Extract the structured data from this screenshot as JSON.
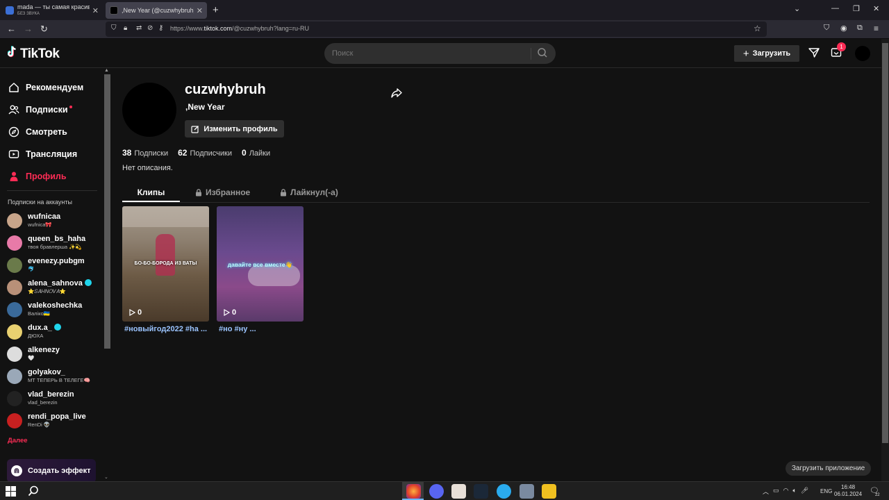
{
  "browser": {
    "tabs": [
      {
        "title": "mada — ты самая красивая (s",
        "subtitle": "БЕЗ ЗВУКА"
      },
      {
        "title": ",New Year (@cuzwhybruh) | Tik"
      }
    ],
    "url_prefix": "https://www.",
    "url_domain": "tiktok.com",
    "url_rest": "/@cuzwhybruh?lang=ru-RU"
  },
  "header": {
    "logo_text": "TikTok",
    "search_placeholder": "Поиск",
    "upload_label": "Загрузить",
    "inbox_badge": "1"
  },
  "sidebar": {
    "nav": [
      {
        "label": "Рекомендуем"
      },
      {
        "label": "Подписки"
      },
      {
        "label": "Смотреть"
      },
      {
        "label": "Трансляция"
      },
      {
        "label": "Профиль"
      }
    ],
    "following_heading": "Подписки на аккаунты",
    "accounts": [
      {
        "name": "wufnicaa",
        "desc": "wufnica🎀",
        "color": "#c8a58a"
      },
      {
        "name": "queen_bs_haha",
        "desc": "твоя бравлерша ✨💫",
        "color": "#e87aa8"
      },
      {
        "name": "evenezy.pubgm",
        "desc": "🐬",
        "color": "#6a7a4a"
      },
      {
        "name": "alena_sahnova",
        "desc": "⭐𝑆𝐴𝐻𝑁𝑂𝑉𝐴⭐",
        "color": "#b89078"
      },
      {
        "name": "valekoshechka",
        "desc": "Валiко🇺🇦",
        "color": "#3a6a9a"
      },
      {
        "name": "dux.a_",
        "desc": "ДЮХА",
        "color": "#e8d070"
      },
      {
        "name": "alkenezy",
        "desc": "🤍",
        "color": "#dddddd"
      },
      {
        "name": "golyakov_",
        "desc": "МТ ТЕПЕРЬ В ТЕЛЕГЕ🧠",
        "color": "#9aa8b8"
      },
      {
        "name": "vlad_berezin",
        "desc": "vlad_berezin",
        "color": "#222222"
      },
      {
        "name": "rendi_popa_live",
        "desc": "RenDi 👽",
        "color": "#c82020"
      }
    ],
    "more_label": "Далее",
    "effect_label": "Создать эффект"
  },
  "profile": {
    "username": "cuzwhybruh",
    "nickname": ",New Year",
    "edit_label": "Изменить профиль",
    "stats": [
      {
        "value": "38",
        "label": "Подписки"
      },
      {
        "value": "62",
        "label": "Подписчики"
      },
      {
        "value": "0",
        "label": "Лайки"
      }
    ],
    "bio": "Нет описания.",
    "tabs": [
      {
        "label": "Клипы"
      },
      {
        "label": "Избранное"
      },
      {
        "label": "Лайкнул(-а)"
      }
    ],
    "videos": [
      {
        "caption": "БО-БО-БОРОДА ИЗ ВАТЫ",
        "views": "0",
        "title": "#новыйгод2022 #ha ..."
      },
      {
        "caption": "давайте все вместе👋",
        "views": "0",
        "title": "#но #ну ..."
      }
    ],
    "get_app_label": "Загрузить приложение"
  },
  "taskbar": {
    "lang": "ENG",
    "time": "16:48",
    "date": "06.01.2024",
    "notif_count": "22"
  },
  "colors": {
    "accent": "#fe2c55",
    "background": "#121212"
  }
}
